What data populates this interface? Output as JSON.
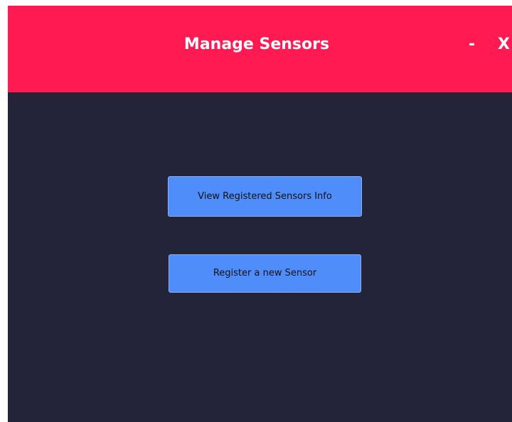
{
  "window": {
    "title": "Manage Sensors",
    "minimize_label": "-",
    "close_label": "X"
  },
  "actions": {
    "view_label": "View Registered Sensors Info",
    "register_label": "Register a new Sensor"
  },
  "colors": {
    "header": "#ff1a52",
    "background": "#23233a",
    "button": "#4f8dfa",
    "page": "#ffffff"
  }
}
